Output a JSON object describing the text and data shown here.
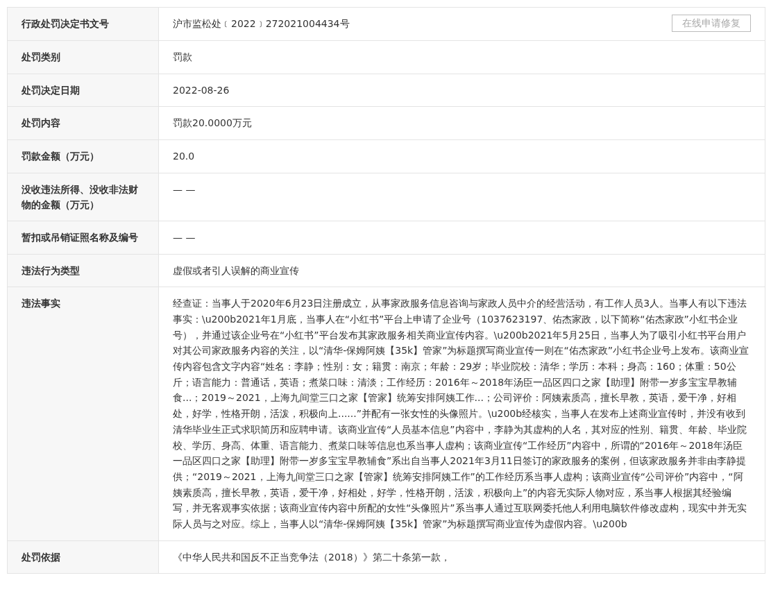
{
  "rows": [
    {
      "label": "行政处罚决定书文号",
      "value": "沪市监松处﹝2022﹞272021004434号",
      "button": "在线申请修复"
    },
    {
      "label": "处罚类别",
      "value": "罚款"
    },
    {
      "label": "处罚决定日期",
      "value": "2022-08-26"
    },
    {
      "label": "处罚内容",
      "value": "罚款20.0000万元"
    },
    {
      "label": "罚款金额（万元）",
      "value": "20.0"
    },
    {
      "label": "没收违法所得、没收非法财物的金额（万元）",
      "value": "— —"
    },
    {
      "label": "暂扣或吊销证照名称及编号",
      "value": "— —"
    },
    {
      "label": "违法行为类型",
      "value": "虚假或者引人误解的商业宣传"
    },
    {
      "label": "违法事实",
      "value": "经查证：当事人于2020年6月23日注册成立，从事家政服务信息咨询与家政人员中介的经营活动，有工作人员3人。当事人有以下违法事实：\\u200b2021年1月底，当事人在“小红书”平台上申请了企业号（1037623197、佑杰家政，以下简称“佑杰家政”小红书企业号），并通过该企业号在“小红书”平台发布其家政服务相关商业宣传内容。\\u200b2021年5月25日，当事人为了吸引小红书平台用户对其公司家政服务内容的关注，以“清华-保姆阿姨【35k】管家”为标题撰写商业宣传一则在“佑杰家政”小红书企业号上发布。该商业宣传内容包含文字内容“姓名：李静；性别：女；籍贯：南京；年龄：29岁；毕业院校：清华；学历：本科；身高：160；体重：50公斤；语言能力：普通话，英语；煮菜口味：清淡；工作经历：2016年～2018年汤臣一品区四口之家【助理】附带一岁多宝宝早教辅食...；2019～2021，上海九间堂三口之家【管家】统筹安排阿姨工作...；公司评价：阿姨素质高，擅长早教，英语，爱干净，好相处，好学，性格开朗，活泼，积极向上......”并配有一张女性的头像照片。\\u200b经核实，当事人在发布上述商业宣传时，并没有收到清华毕业生正式求职简历和应聘申请。该商业宣传“人员基本信息”内容中，李静为其虚构的人名，其对应的性别、籍贯、年龄、毕业院校、学历、身高、体重、语言能力、煮菜口味等信息也系当事人虚构；该商业宣传“工作经历”内容中，所谓的“2016年～2018年汤臣一品区四口之家【助理】附带一岁多宝宝早教辅食”系出自当事人2021年3月11日签订的家政服务的案例，但该家政服务并非由李静提供；“2019～2021，上海九间堂三口之家【管家】统筹安排阿姨工作”的工作经历系当事人虚构；该商业宣传“公司评价”内容中，“阿姨素质高，擅长早教，英语，爱干净，好相处，好学，性格开朗，活泼，积极向上”的内容无实际人物对应，系当事人根据其经验编写，并无客观事实依据；该商业宣传内容中所配的女性“头像照片”系当事人通过互联网委托他人利用电脑软件修改虚构，现实中并无实际人员与之对应。综上，当事人以“清华-保姆阿姨【35k】管家”为标题撰写商业宣传为虚假内容。\\u200b"
    },
    {
      "label": "处罚依据",
      "value": "《中华人民共和国反不正当竞争法（2018）》第二十条第一款，"
    }
  ]
}
